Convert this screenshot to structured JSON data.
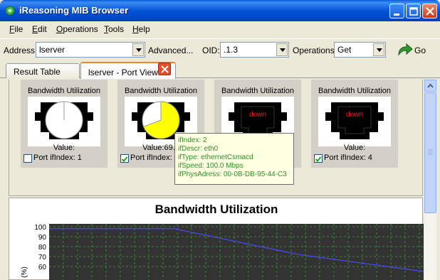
{
  "window": {
    "title": "iReasoning MIB Browser"
  },
  "menu": {
    "items": [
      {
        "hot": "F",
        "rest": "ile"
      },
      {
        "hot": "E",
        "rest": "dit"
      },
      {
        "hot": "O",
        "rest": "perations"
      },
      {
        "hot": "T",
        "rest": "ools"
      },
      {
        "hot": "H",
        "rest": "elp"
      }
    ]
  },
  "toolbar": {
    "address_label": "Address:",
    "address_value": "lserver",
    "advanced_label": "Advanced...",
    "oid_label": "OID:",
    "oid_value": ".1.3",
    "operations_label": "Operations:",
    "operations_value": "Get",
    "go_label": "Go"
  },
  "tabs": {
    "result": "Result Table",
    "port_view": "lserver - Port View"
  },
  "ports": [
    {
      "title": "Bandwidth Utilization",
      "value": "Value:",
      "label": "Port ifIndex: 1",
      "checked": false,
      "status": "pie",
      "utilization": 0
    },
    {
      "title": "Bandwidth Utilization",
      "value": "Value:69.2",
      "label": "Port ifIndex: 2",
      "checked": true,
      "status": "pie",
      "utilization": 0.692
    },
    {
      "title": "Bandwidth Utilization",
      "value": "",
      "label": "",
      "checked": false,
      "status": "down",
      "down_text": "down"
    },
    {
      "title": "Bandwidth Utilization",
      "value": "Value:",
      "label": "Port ifIndex: 4",
      "checked": true,
      "status": "down",
      "down_text": "down"
    }
  ],
  "tooltip": {
    "line1": "ifIndex: 2",
    "line2": "ifDescr: eth0",
    "line3": "ifType: ethernetCsmacd",
    "line4": "ifSpeed: 100.0 Mbps",
    "line5": "ifPhysAdress: 00-0B-DB-95-44-C3"
  },
  "colors": {
    "accent": "#0453d6",
    "pie_fill": "#ffff00",
    "down_text": "#ff1a1a",
    "chart_bg": "#333333",
    "line": "#4a4aff"
  },
  "chart_data": {
    "type": "line",
    "title": "Bandwidth Utilization",
    "ylabel": "(%)",
    "yticks": [
      "100",
      "90",
      "80",
      "70",
      "60"
    ],
    "ylim": [
      55,
      105
    ],
    "grid": true,
    "series": [
      {
        "x": [
          0,
          1,
          2,
          3
        ],
        "values": [
          98,
          98,
          72,
          55
        ]
      }
    ],
    "xlim": [
      0,
      3
    ]
  }
}
